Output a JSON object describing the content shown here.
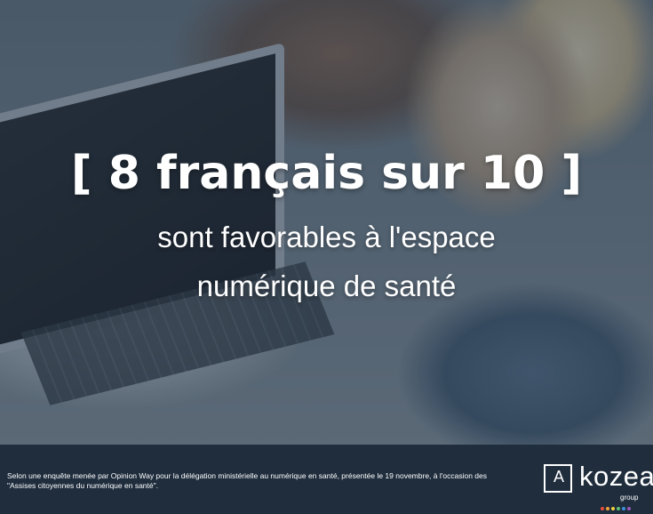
{
  "headline": "[ 8 français sur 10 ]",
  "subline_1": "sont favorables à l'espace",
  "subline_2": "numérique de santé",
  "footnote_line_1": "Selon une enquête menée par Opinion Way pour la délégation ministérielle au numérique en santé, présentée le 19 novembre, à l'occasion des",
  "footnote_line_2": "\"Assises citoyennes du numérique en santé\".",
  "logo": {
    "letter": "A",
    "word": "kozea",
    "tagline": "group",
    "dot_colors": [
      "#e84d3d",
      "#f1a33b",
      "#f4d03f",
      "#5bbd72",
      "#3b8fd9",
      "#9b59b6"
    ]
  },
  "colors": {
    "footer_bg": "#1f2d3d",
    "text": "#ffffff"
  }
}
